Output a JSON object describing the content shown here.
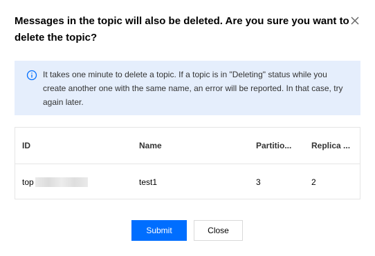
{
  "dialog": {
    "title": "Messages in the topic will also be deleted. Are you sure you want to delete the topic?",
    "close_icon": "close-icon"
  },
  "info": {
    "icon": "info-circle-icon",
    "text": "It takes one minute to delete a topic. If a topic is in \"Deleting\" status while you create another one with the same name, an error will be reported. In that case, try again later."
  },
  "table": {
    "columns": [
      "ID",
      "Name",
      "Partitio...",
      "Replica ..."
    ],
    "rows": [
      {
        "id": "top",
        "name": "test1",
        "partitions": "3",
        "replicas": "2"
      }
    ]
  },
  "buttons": {
    "submit": "Submit",
    "close": "Close"
  },
  "colors": {
    "primary": "#006eff",
    "info_bg": "#e5eefc",
    "info_icon": "#006eff"
  }
}
